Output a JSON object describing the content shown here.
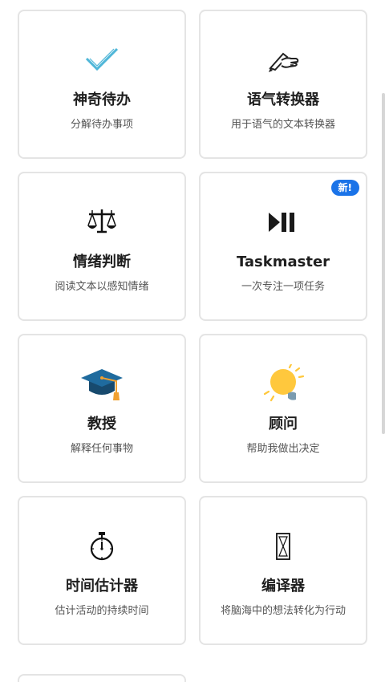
{
  "cards": [
    {
      "title": "神奇待办",
      "description": "分解待办事项",
      "icon": "checkmark-icon",
      "accent": "#4fb6d8"
    },
    {
      "title": "语气转换器",
      "description": "用于语气的文本转换器",
      "icon": "writing-hand-icon"
    },
    {
      "title": "情绪判断",
      "description": "阅读文本以感知情绪",
      "icon": "balance-scale-icon"
    },
    {
      "title": "Taskmaster",
      "description": "一次专注一项任务",
      "icon": "play-pause-icon",
      "badge": "新!",
      "badge_color": "#1a73e8"
    },
    {
      "title": "教授",
      "description": "解释任何事物",
      "icon": "graduation-cap-icon",
      "colors": [
        "#1f5f8b",
        "#f0a030"
      ]
    },
    {
      "title": "顾问",
      "description": "帮助我做出决定",
      "icon": "light-bulb-icon",
      "colors": [
        "#ffc83d",
        "#7a9bb0"
      ]
    },
    {
      "title": "时间估计器",
      "description": "估计活动的持续时间",
      "icon": "stopwatch-icon"
    },
    {
      "title": "编译器",
      "description": "将脑海中的想法转化为行动",
      "icon": "hourglass-icon"
    }
  ]
}
